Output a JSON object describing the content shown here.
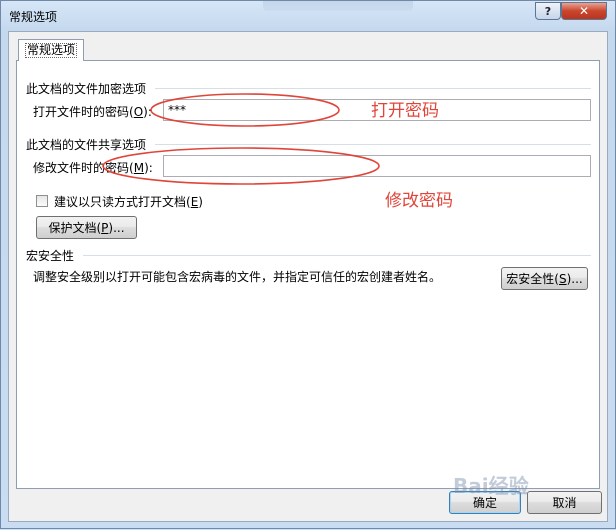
{
  "window": {
    "title": "常规选项",
    "help_label": "?",
    "close_label": "✕"
  },
  "tab": {
    "label": "常规选项"
  },
  "encryption": {
    "group_title": "此文档的文件加密选项",
    "open_password_label": "打开文件时的密码",
    "open_password_hotkey": "O",
    "open_password_value": "***"
  },
  "sharing": {
    "group_title": "此文档的文件共享选项",
    "modify_password_label": "修改文件时的密码",
    "modify_password_hotkey": "M",
    "modify_password_value": "",
    "readonly_checkbox_label": "建议以只读方式打开文档",
    "readonly_checkbox_hotkey": "E",
    "readonly_checked": false,
    "protect_button_label": "保护文档",
    "protect_button_hotkey": "P"
  },
  "macro": {
    "group_title": "宏安全性",
    "description": "调整安全级别以打开可能包含宏病毒的文件，并指定可信任的宏创建者姓名。",
    "button_label": "宏安全性",
    "button_hotkey": "S"
  },
  "footer": {
    "ok_label": "确定",
    "cancel_label": "取消"
  },
  "annotations": {
    "open_password_note": "打开密码",
    "modify_password_note": "修改密码",
    "color": "#e0453a"
  },
  "watermark": {
    "text": "Bai经验"
  }
}
